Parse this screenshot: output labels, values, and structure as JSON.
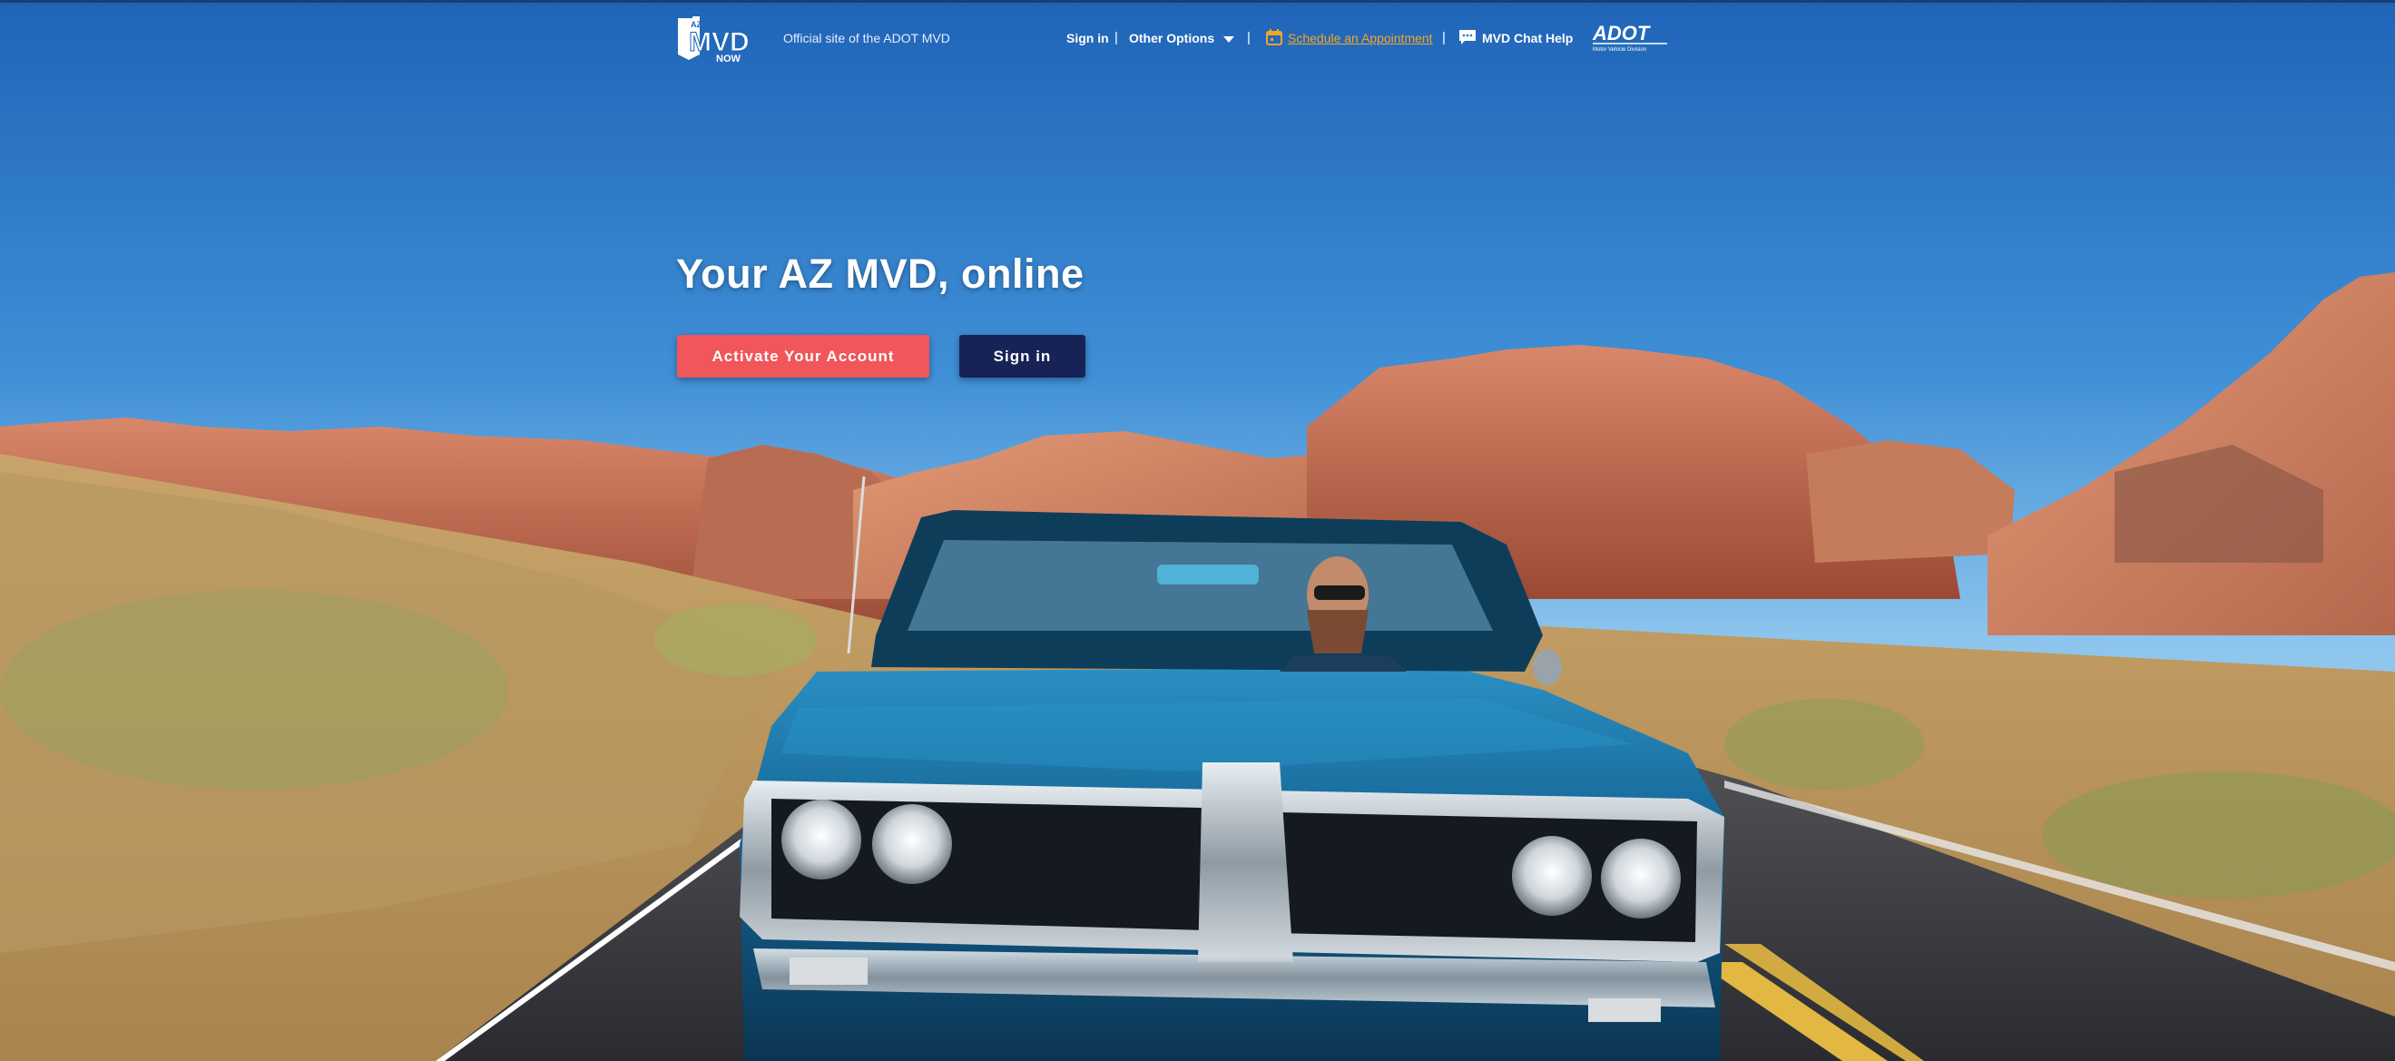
{
  "header": {
    "tagline": "Official site of the ADOT MVD",
    "nav": {
      "sign_in": "Sign in",
      "other_options": "Other Options",
      "schedule": "Schedule an Appointment",
      "chat": "MVD Chat Help",
      "separator": "|"
    },
    "logo": {
      "line1": "AZ",
      "line2": "MVD",
      "line3": "NOW"
    },
    "adot_logo": {
      "name": "ADOT",
      "sub": "Motor Vehicle Division"
    },
    "icons": {
      "calendar": "calendar-icon",
      "chat": "chat-bubble-icon",
      "dropdown": "caret-down-icon"
    }
  },
  "hero": {
    "headline": "Your AZ MVD, online",
    "activate_label": "Activate Your Account",
    "signin_label": "Sign in"
  },
  "colors": {
    "accent_red": "#f0565a",
    "navy": "#172357",
    "appointment_orange": "#f5a623",
    "sky": "#2b73c4"
  }
}
